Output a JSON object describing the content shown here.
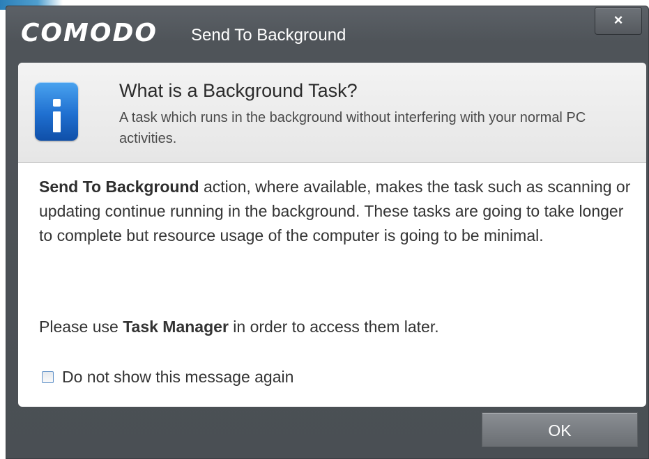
{
  "window": {
    "brand": "COMODO",
    "title": "Send To Background",
    "close_label": "×"
  },
  "info_header": {
    "icon": "info-icon",
    "heading": "What is a Background Task?",
    "description": "A task which runs in the background without interfering with your normal PC activities."
  },
  "body": {
    "paragraph1_bold": "Send To Background",
    "paragraph1_rest": " action, where available, makes the task such as scanning or updating continue running in the background. These tasks are going to take longer to complete but resource usage of the computer is going to be minimal.",
    "paragraph2_prefix": "Please use ",
    "paragraph2_bold": "Task Manager",
    "paragraph2_suffix": " in order to access them later."
  },
  "checkbox": {
    "label": "Do not show this message again",
    "checked": false
  },
  "footer": {
    "ok_label": "OK"
  },
  "colors": {
    "window_bg": "#4f5459",
    "panel_bg": "#ffffff",
    "icon_blue": "#1f6fd0",
    "ok_button": "#7a7e83"
  }
}
